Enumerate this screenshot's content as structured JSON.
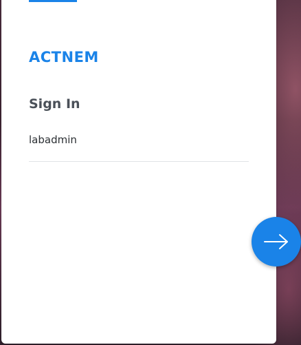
{
  "login_card": {
    "brand": "ACTNEM",
    "heading": "Sign In",
    "username_value": "labadmin"
  },
  "next_button": {
    "icon": "arrow-right-icon"
  },
  "colors": {
    "accent": "#1a83e8",
    "heading_text": "#4a5058",
    "card_background": "#ffffff"
  }
}
